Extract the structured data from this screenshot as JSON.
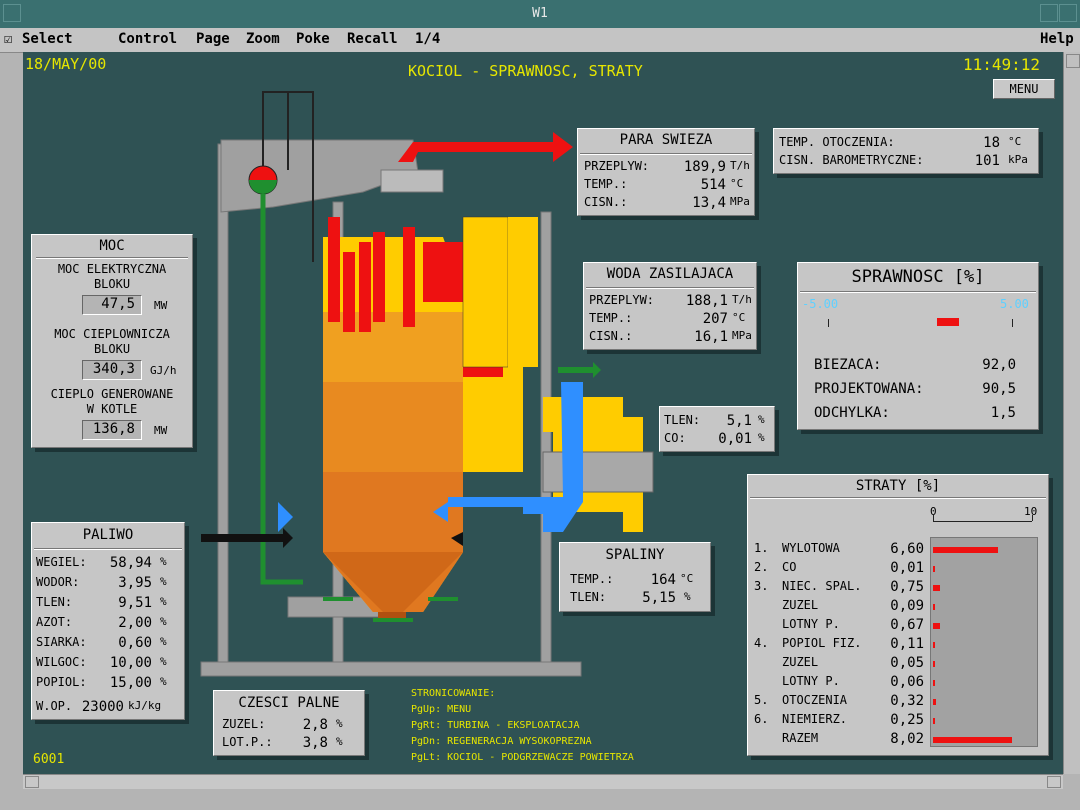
{
  "window": {
    "title": "W1"
  },
  "menubar": {
    "select": "Select",
    "control": "Control",
    "page": "Page",
    "zoom": "Zoom",
    "poke": "Poke",
    "recall": "Recall",
    "page_no": "1/4",
    "help": "Help"
  },
  "header": {
    "date": "18/MAY/00",
    "title": "KOCIOL - SPRAWNOSC, STRATY",
    "time": "11:49:12",
    "menu": "MENU"
  },
  "para": {
    "title": "PARA SWIEZA",
    "rows": [
      {
        "label": "PRZEPLYW:",
        "value": "189,9",
        "unit": "T/h"
      },
      {
        "label": "TEMP.:",
        "value": "514",
        "unit": "°C"
      },
      {
        "label": "CISN.:",
        "value": "13,4",
        "unit": "MPa"
      }
    ]
  },
  "ambient": {
    "rows": [
      {
        "label": "TEMP. OTOCZENIA:",
        "value": "18",
        "unit": "°C"
      },
      {
        "label": "CISN. BAROMETRYCZNE:",
        "value": "101",
        "unit": "kPa"
      }
    ]
  },
  "woda": {
    "title": "WODA ZASILAJACA",
    "rows": [
      {
        "label": "PRZEPLYW:",
        "value": "188,1",
        "unit": "T/h"
      },
      {
        "label": "TEMP.:",
        "value": "207",
        "unit": "°C"
      },
      {
        "label": "CISN.:",
        "value": "16,1",
        "unit": "MPa"
      }
    ]
  },
  "sprawnosc": {
    "title": "SPRAWNOSC [%]",
    "scale_min": "-5.00",
    "scale_max": "5.00",
    "deviation_fraction": 0.65,
    "rows": [
      {
        "label": "BIEZACA:",
        "value": "92,0"
      },
      {
        "label": "PROJEKTOWANA:",
        "value": "90,5"
      },
      {
        "label": "ODCHYLKA:",
        "value": "1,5"
      }
    ]
  },
  "moc": {
    "title": "MOC",
    "items": [
      {
        "label1": "MOC ELEKTRYCZNA",
        "label2": "BLOKU",
        "value": "47,5",
        "unit": "MW"
      },
      {
        "label1": "MOC CIEPLOWNICZA",
        "label2": "BLOKU",
        "value": "340,3",
        "unit": "GJ/h"
      },
      {
        "label1": "CIEPLO GENEROWANE",
        "label2": "W KOTLE",
        "value": "136,8",
        "unit": "MW"
      }
    ]
  },
  "tlen": {
    "rows": [
      {
        "label": "TLEN:",
        "value": "5,1",
        "unit": "%"
      },
      {
        "label": "CO:",
        "value": "0,01",
        "unit": "%"
      }
    ]
  },
  "paliwo": {
    "title": "PALIWO",
    "rows": [
      {
        "label": "WEGIEL:",
        "value": "58,94",
        "unit": "%"
      },
      {
        "label": "WODOR:",
        "value": "3,95",
        "unit": "%"
      },
      {
        "label": "TLEN:",
        "value": "9,51",
        "unit": "%"
      },
      {
        "label": "AZOT:",
        "value": "2,00",
        "unit": "%"
      },
      {
        "label": "SIARKA:",
        "value": "0,60",
        "unit": "%"
      },
      {
        "label": "WILGOC:",
        "value": "10,00",
        "unit": "%"
      },
      {
        "label": "POPIOL:",
        "value": "15,00",
        "unit": "%"
      }
    ],
    "wop_label": "W.OP.",
    "wop_value": "23000",
    "wop_unit": "kJ/kg"
  },
  "spaliny": {
    "title": "SPALINY",
    "rows": [
      {
        "label": "TEMP.:",
        "value": "164",
        "unit": "°C"
      },
      {
        "label": "TLEN:",
        "value": "5,15",
        "unit": "%"
      }
    ]
  },
  "czesci": {
    "title": "CZESCI PALNE",
    "rows": [
      {
        "label": "ZUZEL:",
        "value": "2,8",
        "unit": "%"
      },
      {
        "label": "LOT.P.:",
        "value": "3,8",
        "unit": "%"
      }
    ]
  },
  "straty": {
    "title": "STRATY [%]",
    "axis_min": "0",
    "axis_max": "10",
    "rows": [
      {
        "num": "1.",
        "label": "WYLOTOWA",
        "value": "6,60",
        "v": 6.6
      },
      {
        "num": "2.",
        "label": "CO",
        "value": "0,01",
        "v": 0.01
      },
      {
        "num": "3.",
        "label": "NIEC. SPAL.",
        "value": "0,75",
        "v": 0.75
      },
      {
        "num": "",
        "label": "ZUZEL",
        "value": "0,09",
        "v": 0.09
      },
      {
        "num": "",
        "label": "LOTNY P.",
        "value": "0,67",
        "v": 0.67
      },
      {
        "num": "4.",
        "label": "POPIOL FIZ.",
        "value": "0,11",
        "v": 0.11
      },
      {
        "num": "",
        "label": "ZUZEL",
        "value": "0,05",
        "v": 0.05
      },
      {
        "num": "",
        "label": "LOTNY P.",
        "value": "0,06",
        "v": 0.06
      },
      {
        "num": "5.",
        "label": "OTOCZENIA",
        "value": "0,32",
        "v": 0.32
      },
      {
        "num": "6.",
        "label": "NIEMIERZ.",
        "value": "0,25",
        "v": 0.25
      },
      {
        "num": "",
        "label": "RAZEM",
        "value": "8,02",
        "v": 8.02
      }
    ]
  },
  "stronicowanie": {
    "title": "STRONICOWANIE:",
    "lines": [
      "PgUp: MENU",
      "PgRt: TURBINA - EKSPLOATACJA",
      "PgDn: REGENERACJA WYSOKOPREZNA",
      "PgLt: KOCIOL - PODGRZEWACZE POWIETRZA"
    ]
  },
  "footer": {
    "code": "6001"
  },
  "colors": {
    "bg": "#2f5254",
    "panel": "#c6c6c6",
    "yellow": "#e6e600",
    "red": "#ee1111",
    "blue": "#2f8fff",
    "green": "#1f8f2f"
  }
}
